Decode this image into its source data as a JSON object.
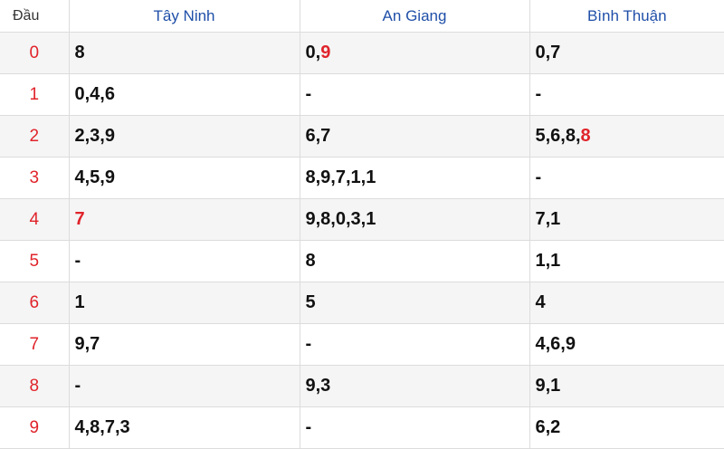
{
  "header": {
    "dau": "Đầu",
    "provinces": [
      "Tây Ninh",
      "An Giang",
      "Bình Thuận"
    ]
  },
  "rows": [
    {
      "dau": "0",
      "cells": [
        {
          "plain": "8",
          "hl": ""
        },
        {
          "plain": "0,",
          "hl": "9"
        },
        {
          "plain": "0,7",
          "hl": ""
        }
      ]
    },
    {
      "dau": "1",
      "cells": [
        {
          "plain": "0,4,6",
          "hl": ""
        },
        {
          "plain": "-",
          "hl": ""
        },
        {
          "plain": "-",
          "hl": ""
        }
      ]
    },
    {
      "dau": "2",
      "cells": [
        {
          "plain": "2,3,9",
          "hl": ""
        },
        {
          "plain": "6,7",
          "hl": ""
        },
        {
          "plain": "5,6,8,",
          "hl": "8"
        }
      ]
    },
    {
      "dau": "3",
      "cells": [
        {
          "plain": "4,5,9",
          "hl": ""
        },
        {
          "plain": "8,9,7,1,1",
          "hl": ""
        },
        {
          "plain": "-",
          "hl": ""
        }
      ]
    },
    {
      "dau": "4",
      "cells": [
        {
          "plain": "",
          "hl": "7"
        },
        {
          "plain": "9,8,0,3,1",
          "hl": ""
        },
        {
          "plain": "7,1",
          "hl": ""
        }
      ]
    },
    {
      "dau": "5",
      "cells": [
        {
          "plain": "-",
          "hl": ""
        },
        {
          "plain": "8",
          "hl": ""
        },
        {
          "plain": "1,1",
          "hl": ""
        }
      ]
    },
    {
      "dau": "6",
      "cells": [
        {
          "plain": "1",
          "hl": ""
        },
        {
          "plain": "5",
          "hl": ""
        },
        {
          "plain": "4",
          "hl": ""
        }
      ]
    },
    {
      "dau": "7",
      "cells": [
        {
          "plain": "9,7",
          "hl": ""
        },
        {
          "plain": "-",
          "hl": ""
        },
        {
          "plain": "4,6,9",
          "hl": ""
        }
      ]
    },
    {
      "dau": "8",
      "cells": [
        {
          "plain": "-",
          "hl": ""
        },
        {
          "plain": "9,3",
          "hl": ""
        },
        {
          "plain": "9,1",
          "hl": ""
        }
      ]
    },
    {
      "dau": "9",
      "cells": [
        {
          "plain": "4,8,7,3",
          "hl": ""
        },
        {
          "plain": "-",
          "hl": ""
        },
        {
          "plain": "6,2",
          "hl": ""
        }
      ]
    }
  ],
  "colors": {
    "header_text": "#1f4fa8",
    "highlight": "#e0232a",
    "row_stripe": "#f5f5f5",
    "grid_line": "#dcdcdc"
  }
}
